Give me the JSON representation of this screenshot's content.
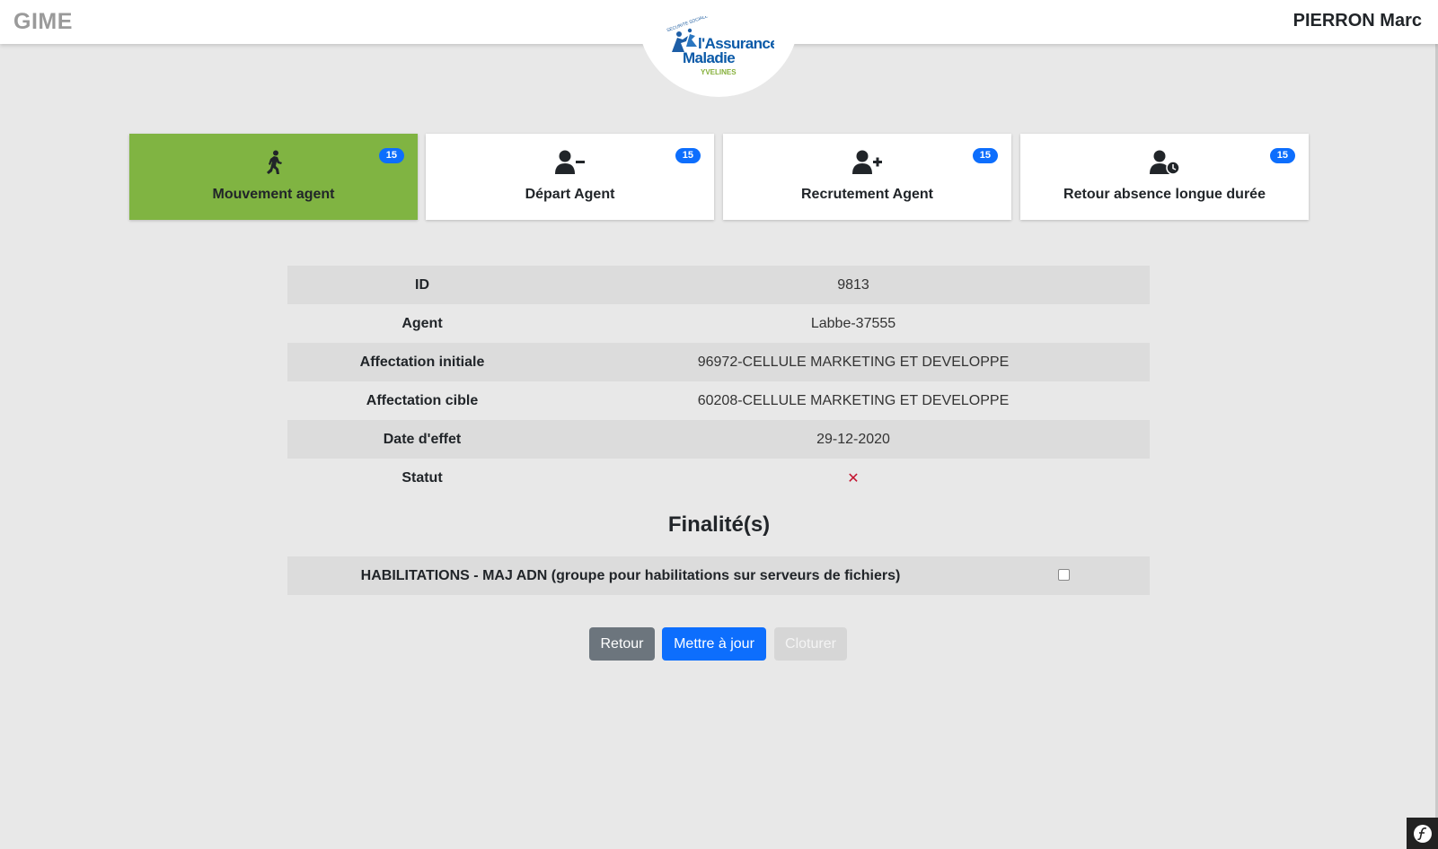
{
  "header": {
    "app_name": "GIME",
    "user_name": "PIERRON Marc",
    "logo": {
      "top_text": "SECURITE SOCIALE",
      "line1": "l'Assurance",
      "line2": "Maladie",
      "line3": "YVELINES"
    }
  },
  "cards": [
    {
      "label": "Mouvement agent",
      "badge": "15",
      "icon": "walking-person-icon",
      "active": true
    },
    {
      "label": "Départ Agent",
      "badge": "15",
      "icon": "user-minus-icon",
      "active": false
    },
    {
      "label": "Recrutement Agent",
      "badge": "15",
      "icon": "user-plus-icon",
      "active": false
    },
    {
      "label": "Retour absence longue durée",
      "badge": "15",
      "icon": "user-clock-icon",
      "active": false
    }
  ],
  "details": [
    {
      "key": "ID",
      "value": "9813"
    },
    {
      "key": "Agent",
      "value": "Labbe-37555"
    },
    {
      "key": "Affectation initiale",
      "value": "96972-CELLULE MARKETING ET DEVELOPPE"
    },
    {
      "key": "Affectation cible",
      "value": "60208-CELLULE MARKETING ET DEVELOPPE"
    },
    {
      "key": "Date d'effet",
      "value": "29-12-2020"
    },
    {
      "key": "Statut",
      "value": "✕"
    }
  ],
  "finalites": {
    "title": "Finalité(s)",
    "items": [
      {
        "label": "HABILITATIONS - MAJ ADN (groupe pour habilitations sur serveurs de fichiers)",
        "checked": false
      }
    ]
  },
  "buttons": {
    "retour": "Retour",
    "mettre_a_jour": "Mettre à jour",
    "cloturer": "Cloturer"
  },
  "colors": {
    "active_card": "#80b442",
    "badge": "#0d6efd",
    "status_error": "#c4132f",
    "btn_secondary": "#6c757d",
    "btn_primary": "#0d6efd"
  }
}
